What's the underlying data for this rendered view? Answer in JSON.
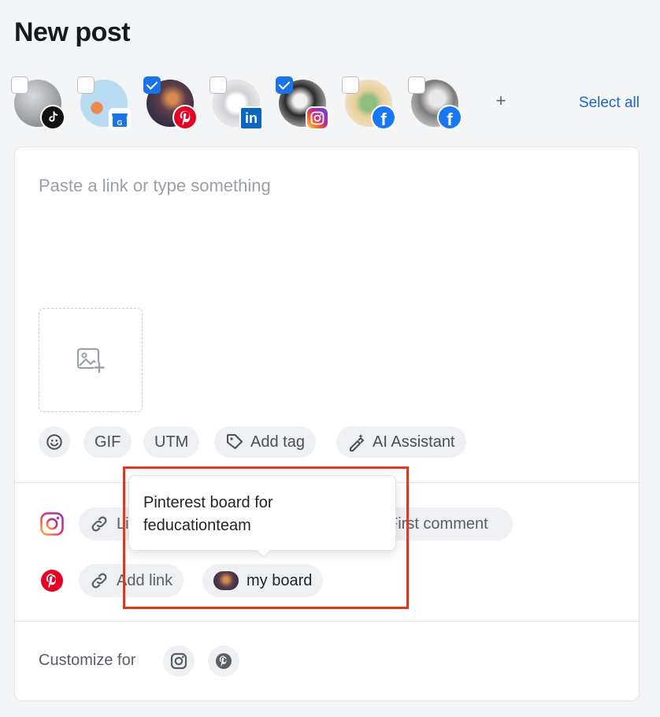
{
  "page": {
    "title": "New post"
  },
  "accounts": [
    {
      "network": "tiktok",
      "checked": false,
      "badge_color": "#111111"
    },
    {
      "network": "google-business",
      "checked": false,
      "badge_color": "#1a73e8"
    },
    {
      "network": "pinterest",
      "checked": true,
      "badge_color": "#e60023"
    },
    {
      "network": "linkedin",
      "checked": false,
      "badge_color": "#0a66c2"
    },
    {
      "network": "instagram",
      "checked": true,
      "badge_color": "#d62976"
    },
    {
      "network": "facebook",
      "checked": false,
      "badge_color": "#1877f2"
    },
    {
      "network": "facebook",
      "checked": false,
      "badge_color": "#1877f2"
    }
  ],
  "account_actions": {
    "add_icon": "+",
    "select_all": "Select all"
  },
  "composer": {
    "placeholder": "Paste a link or type something"
  },
  "toolbar": {
    "emoji_icon": "emoji-icon",
    "gif": "GIF",
    "utm": "UTM",
    "add_tag": "Add tag",
    "ai_assistant": "AI Assistant"
  },
  "networks": {
    "instagram": {
      "add_link": "Li",
      "first_comment": "First comment"
    },
    "pinterest": {
      "add_link": "Add link",
      "board": "my board"
    }
  },
  "tooltip": {
    "line1": "Pinterest board for",
    "line2": "feducationteam"
  },
  "customize": {
    "label": "Customize for"
  },
  "colors": {
    "accent": "#1a73e8",
    "link": "#1a66c9",
    "highlight": "#e3361b",
    "pinterest": "#e60023",
    "instagram": "#d62976"
  }
}
